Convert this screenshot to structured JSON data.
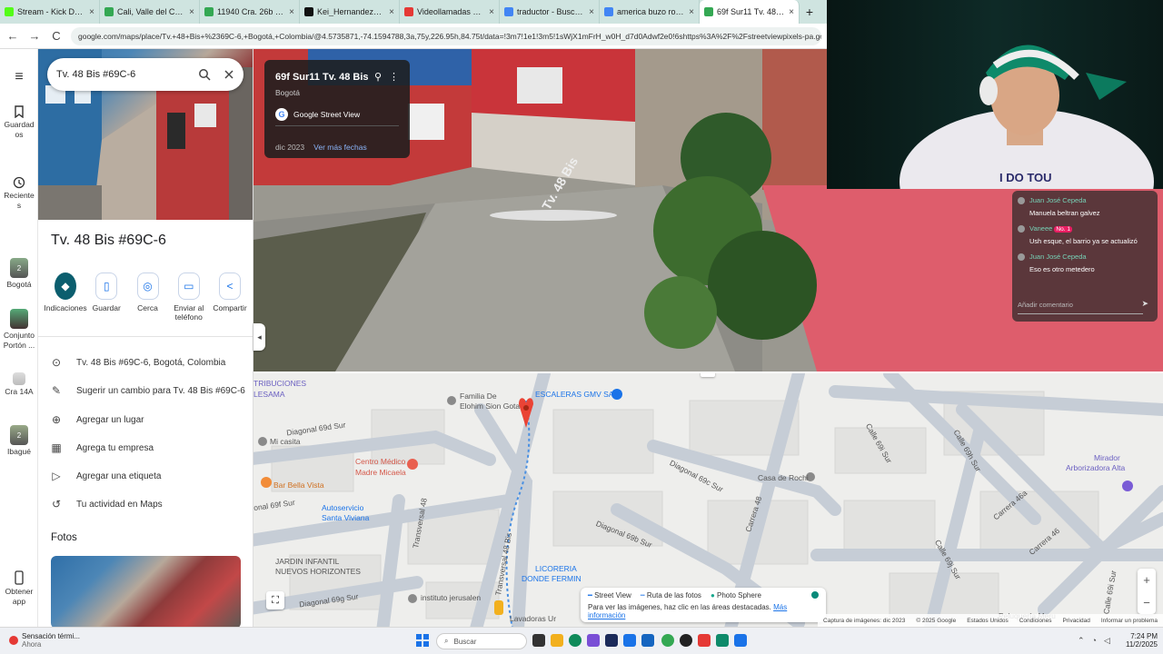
{
  "browser": {
    "tabs": [
      {
        "label": "Stream - Kick Dashboard",
        "color": "#53fc18"
      },
      {
        "label": "Cali, Valle del Cauca - Google M",
        "color": "#34a853"
      },
      {
        "label": "11940 Cra. 26b 3 - Google Map",
        "color": "#34a853"
      },
      {
        "label": "Kei_Hernandez0 (@kei_hernan",
        "color": "#111111"
      },
      {
        "label": "Videollamadas OmeTV — A",
        "color": "#e53935"
      },
      {
        "label": "traductor - Buscar con Google",
        "color": "#4285f4"
      },
      {
        "label": "america buzo rojo con negro h",
        "color": "#4285f4"
      },
      {
        "label": "69f Sur11 Tv. 48 Bis - Google M",
        "color": "#34a853"
      }
    ],
    "new_tab": "+",
    "back": "←",
    "forward": "→",
    "reload": "C",
    "url": "google.com/maps/place/Tv.+48+Bis+%2369C-6,+Bogotá,+Colombia/@4.5735871,-74.1594788,3a,75y,226.95h,84.75t/data=!3m7!1e1!3m5!1sWjX1mFrH_w0H_d7d0Adwf2e0!6shttps%3A%2F%2Fstreetviewpixels-pa.googleapis.com%2Fv1%2Fthumbnail%3Fcb_client%3Dmaps_sv.tactile%26w%3D900"
  },
  "rail": {
    "menu_icon": "≡",
    "items": [
      {
        "label": "Guardados",
        "icon": "bookmark-icon"
      },
      {
        "label": "Recientes",
        "icon": "history-icon"
      },
      {
        "label": "Bogotá",
        "badge": "2"
      },
      {
        "label": "Conjunto Portón ..."
      },
      {
        "label": "Cra 14A"
      },
      {
        "label": "Ibagué",
        "badge": "2"
      },
      {
        "label": "Obtener app",
        "icon": "phone-icon"
      }
    ]
  },
  "panel": {
    "search_value": "Tv. 48 Bis #69C-6",
    "place_title": "Tv. 48 Bis #69C-6",
    "actions": [
      {
        "label": "Indicaciones",
        "glyph": "◆"
      },
      {
        "label": "Guardar",
        "glyph": "▯"
      },
      {
        "label": "Cerca",
        "glyph": "◎"
      },
      {
        "label": "Enviar al teléfono",
        "glyph": "▭"
      },
      {
        "label": "Compartir",
        "glyph": "<"
      }
    ],
    "rows": [
      {
        "label": "Tv. 48 Bis #69C-6, Bogotá, Colombia",
        "glyph": "⊙"
      },
      {
        "label": "Sugerir un cambio para Tv. 48 Bis #69C-6",
        "glyph": "✎"
      },
      {
        "label": "Agregar un lugar",
        "glyph": "⊕"
      },
      {
        "label": "Agrega tu empresa",
        "glyph": "▦"
      },
      {
        "label": "Agregar una etiqueta",
        "glyph": "▷"
      },
      {
        "label": "Tu actividad en Maps",
        "glyph": "↺"
      }
    ],
    "photos_heading": "Fotos"
  },
  "streetview": {
    "address": "69f Sur11 Tv. 48 Bis",
    "city": "Bogotá",
    "provider": "Google Street View",
    "date": "dic 2023",
    "more_dates": "Ver más fechas",
    "road_label": "Tv. 48 Bis"
  },
  "map": {
    "labels": [
      "TRIBUCIONES",
      "LESAMA",
      "Familia De",
      "Elohim Sion Gota",
      "ESCALERAS GMV SAS",
      "Diagonal 69d Sur",
      "Mi casita",
      "Centro Médico",
      "Madre Micaela",
      "Bar Bella Vista",
      "Autoservicio",
      "Santa Viviana",
      "onal 69f Sur",
      "Transversal 48",
      "Diagonal 69c Sur",
      "Casa de Rochi",
      "Carrera 48",
      "Calle 69i Sur",
      "Calle 69h Sur",
      "Diagonal 69b Sur",
      "Carrera 46a",
      "Mirador",
      "Arborizadora Alta",
      "JARDIN INFANTIL",
      "NUEVOS HORIZONTES",
      "Diagonal 69g Sur",
      "instituto jerusalen",
      "Transversal 48 Bis",
      "LICORERIA",
      "DONDE FERMIN",
      "Lavadoras Ur",
      "Calle 69j Sur",
      "Carrera 46",
      "Peluquería Meru",
      "Calle 69i Sur"
    ],
    "legend": {
      "items": [
        "Street View",
        "Ruta de las fotos",
        "Photo Sphere"
      ],
      "hint": "Para ver las imágenes, haz clic en las áreas destacadas.",
      "link": "Más información"
    },
    "attribution": [
      "Captura de imágenes: dic 2023",
      "© 2025 Google",
      "Estados Unidos",
      "Condiciones",
      "Privacidad",
      "Informar un problema"
    ],
    "zoom_in": "+",
    "zoom_out": "−"
  },
  "chat": {
    "messages": [
      {
        "user": "Juan José Cepeda",
        "text": "Manuela beltran galvez"
      },
      {
        "user": "Vaneee",
        "badge": "No. 1",
        "text": "Ush esque, el barrio ya se actualizó"
      },
      {
        "user": "Juan José Cepeda",
        "text": "Eso es otro metedero"
      }
    ],
    "placeholder": "Añadir comentario"
  },
  "webcam": {
    "shirt_text": "I DO TOU"
  },
  "taskbar": {
    "notification_title": "Sensación térmi...",
    "notification_sub": "Ahora",
    "search_placeholder": "Buscar",
    "time": "7:24 PM",
    "date": "11/2/2025"
  },
  "colors": {
    "accent": "#1a73e8",
    "primary_action": "#0b5e6e",
    "pin": "#ea4335"
  }
}
